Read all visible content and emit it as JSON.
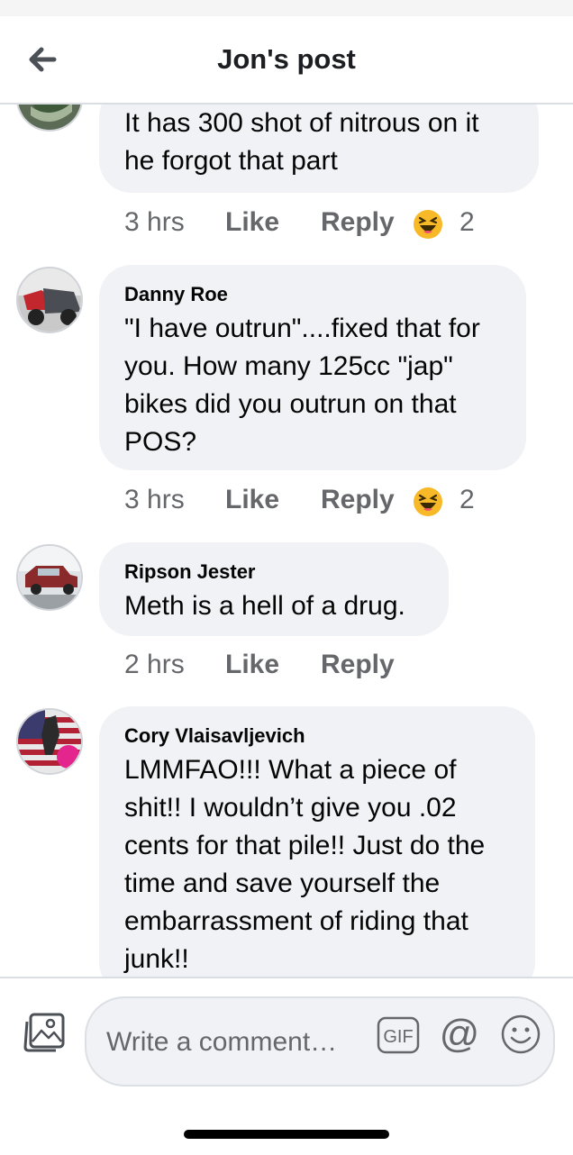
{
  "header": {
    "title": "Jon's post",
    "back_icon": "back-arrow-icon"
  },
  "comments": [
    {
      "author": "",
      "text_lines": [
        "It has 300 shot of nitrous  on it",
        "he forgot  that part"
      ],
      "time": "3 hrs",
      "like": "Like",
      "reply": "Reply",
      "reaction_icon": "haha-emoji-icon",
      "reaction_count": "2"
    },
    {
      "author": "Danny Roe",
      "text_lines": [
        "\"I have outrun\"....fixed that for",
        "you.  How many 125cc \"jap\"",
        "bikes did you outrun on that",
        "POS?"
      ],
      "time": "3 hrs",
      "like": "Like",
      "reply": "Reply",
      "reaction_icon": "haha-emoji-icon",
      "reaction_count": "2"
    },
    {
      "author": "Ripson Jester",
      "text_lines": [
        "Meth is a hell of a drug."
      ],
      "time": "2 hrs",
      "like": "Like",
      "reply": "Reply"
    },
    {
      "author": "Cory Vlaisavljevich",
      "text_lines": [
        "LMMFAO!!! What a piece of",
        "shit!! I wouldn’t give you .02",
        "cents for that pile!! Just do the",
        "time and save yourself the",
        "embarrassment of riding that",
        "junk!!"
      ]
    }
  ],
  "composer": {
    "placeholder": "Write a comment…",
    "gif_label": "GIF",
    "at_label": "@",
    "photo_icon": "photo-icon",
    "emoji_icon": "smiley-icon"
  },
  "colors": {
    "bubble": "#f0f2f5",
    "text": "#050505",
    "meta": "#65676b",
    "haha": "#f7b928"
  }
}
